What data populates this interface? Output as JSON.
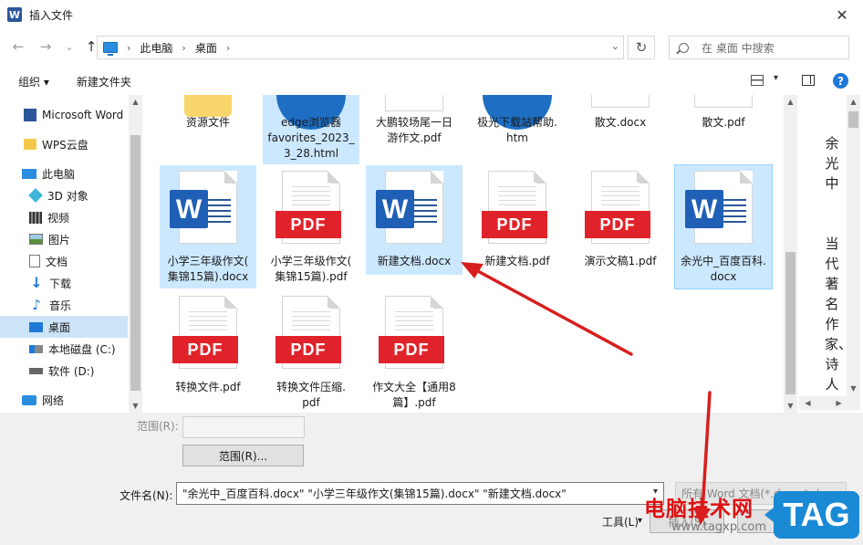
{
  "window": {
    "title": "插入文件",
    "app_icon_letter": "W",
    "close_glyph": "✕"
  },
  "nav_buttons": {
    "back": "←",
    "forward": "→",
    "recent": "⌄",
    "up": "↑"
  },
  "address": {
    "crumbs": [
      "此电脑",
      "桌面"
    ],
    "separator": "›",
    "dropdown": "⌄",
    "refresh": "↻"
  },
  "search": {
    "placeholder": "在 桌面 中搜索"
  },
  "toolbar": {
    "organize": "组织 ▾",
    "new_folder": "新建文件夹",
    "view_dropdown": "▾",
    "help": "?"
  },
  "sidebar": {
    "items": [
      {
        "label": "Microsoft Word",
        "icon": "word-icon"
      },
      {
        "label": "WPS云盘",
        "icon": "folder-icon"
      },
      {
        "label": "此电脑",
        "icon": "computer-icon"
      },
      {
        "label": "3D 对象",
        "icon": "cube-icon"
      },
      {
        "label": "视频",
        "icon": "video-icon"
      },
      {
        "label": "图片",
        "icon": "picture-icon"
      },
      {
        "label": "文档",
        "icon": "document-icon"
      },
      {
        "label": "下载",
        "icon": "download-icon"
      },
      {
        "label": "音乐",
        "icon": "music-icon"
      },
      {
        "label": "桌面",
        "icon": "desktop-icon",
        "selected": true
      },
      {
        "label": "本地磁盘 (C:)",
        "icon": "drive-icon"
      },
      {
        "label": "软件 (D:)",
        "icon": "drive-icon"
      },
      {
        "label": "网络",
        "icon": "network-icon"
      }
    ]
  },
  "files": [
    {
      "lines": [
        "资源文件"
      ],
      "type": "folder"
    },
    {
      "lines": [
        "edge浏览器",
        "favorites_2023_",
        "3_28.html"
      ],
      "type": "html",
      "selected": true
    },
    {
      "lines": [
        "大鹏较场尾一日",
        "游作文.pdf"
      ],
      "type": "pdf"
    },
    {
      "lines": [
        "极光下载站帮助.",
        "htm"
      ],
      "type": "html"
    },
    {
      "lines": [
        "散文.docx"
      ],
      "type": "docx"
    },
    {
      "lines": [
        "散文.pdf"
      ],
      "type": "pdf"
    },
    {
      "lines": [
        "小学三年级作文(",
        "集锦15篇).docx"
      ],
      "type": "docx",
      "selected": true
    },
    {
      "lines": [
        "小学三年级作文(",
        "集锦15篇).pdf"
      ],
      "type": "pdf"
    },
    {
      "lines": [
        "新建文档.docx"
      ],
      "type": "docx",
      "selected": true
    },
    {
      "lines": [
        "新建文档.pdf"
      ],
      "type": "pdf"
    },
    {
      "lines": [
        "演示文稿1.pdf"
      ],
      "type": "pdf"
    },
    {
      "lines": [
        "余光中_百度百科.",
        "docx"
      ],
      "type": "docx",
      "selected": true
    },
    {
      "lines": [
        "转换文件.pdf"
      ],
      "type": "pdf"
    },
    {
      "lines": [
        "转换文件压缩.",
        "pdf"
      ],
      "type": "pdf"
    },
    {
      "lines": [
        "作文大全【通用8",
        "篇】.pdf"
      ],
      "type": "pdf"
    }
  ],
  "file_badges": {
    "pdf": "PDF",
    "word": "W"
  },
  "preview": {
    "text": [
      "余",
      "光",
      "中",
      "",
      "",
      "当",
      "代",
      "著",
      "名",
      "作",
      "家、",
      "诗",
      "人"
    ]
  },
  "scroll_glyphs": {
    "up": "▲",
    "down": "▼",
    "left": "◀",
    "right": "▶"
  },
  "bottom": {
    "range_label": "范围(R):",
    "range_button": "范围(R)...",
    "filename_label": "文件名(N):",
    "filename_value": "\"余光中_百度百科.docx\" \"小学三年级作文(集锦15篇).docx\" \"新建文档.docx\"",
    "filename_dropdown": "▾",
    "filetype_value": "所有 Word 文档(*.docx;*.docm;*.dotx",
    "tools_label": "工具(L)",
    "tools_dropdown": "▾",
    "insert_button": "插入(S)"
  },
  "watermark": {
    "site_name": "电脑技术网",
    "url": "www.tagxp.com",
    "tag": "TAG"
  },
  "colors": {
    "selection": "#cce8ff",
    "nav_selected": "#cce4f7",
    "pdf_red": "#e0232a",
    "word_blue": "#1f5fb6",
    "annotation_red": "#d81e1e"
  }
}
